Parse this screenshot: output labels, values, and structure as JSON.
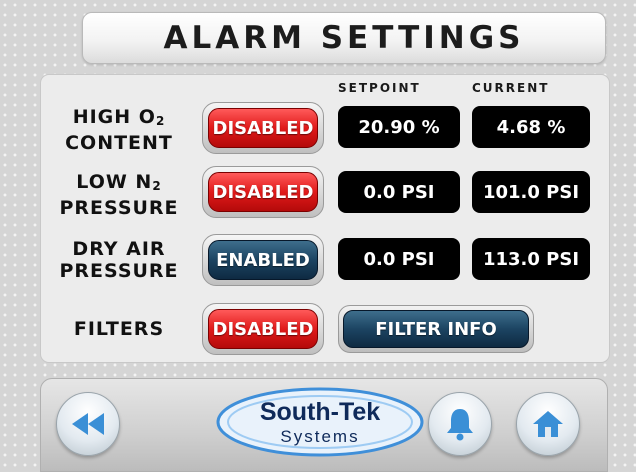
{
  "title": "ALARM SETTINGS",
  "columns": {
    "setpoint": "SETPOINT",
    "current": "CURRENT"
  },
  "rows": [
    {
      "label_line1": "HIGH O",
      "label_sub1": "2",
      "label_line2": "CONTENT",
      "status": "DISABLED",
      "setpoint": "20.90 %",
      "current": "4.68 %"
    },
    {
      "label_line1": "LOW N",
      "label_sub1": "2",
      "label_line2": "PRESSURE",
      "status": "DISABLED",
      "setpoint": "0.0 PSI",
      "current": "101.0 PSI"
    },
    {
      "label_line1": "DRY AIR",
      "label_line2": "PRESSURE",
      "status": "ENABLED",
      "setpoint": "0.0 PSI",
      "current": "113.0 PSI"
    },
    {
      "label_line1": "FILTERS",
      "status": "DISABLED",
      "action": "FILTER INFO"
    }
  ],
  "logo": {
    "line1": "South-Tek",
    "line2": "Systems"
  },
  "icons": {
    "back": "rewind-icon",
    "alarm": "bell-icon",
    "home": "home-icon"
  },
  "colors": {
    "disabled": "#e01a1a",
    "enabled": "#1c4462",
    "logo": "#0f2a5a"
  }
}
